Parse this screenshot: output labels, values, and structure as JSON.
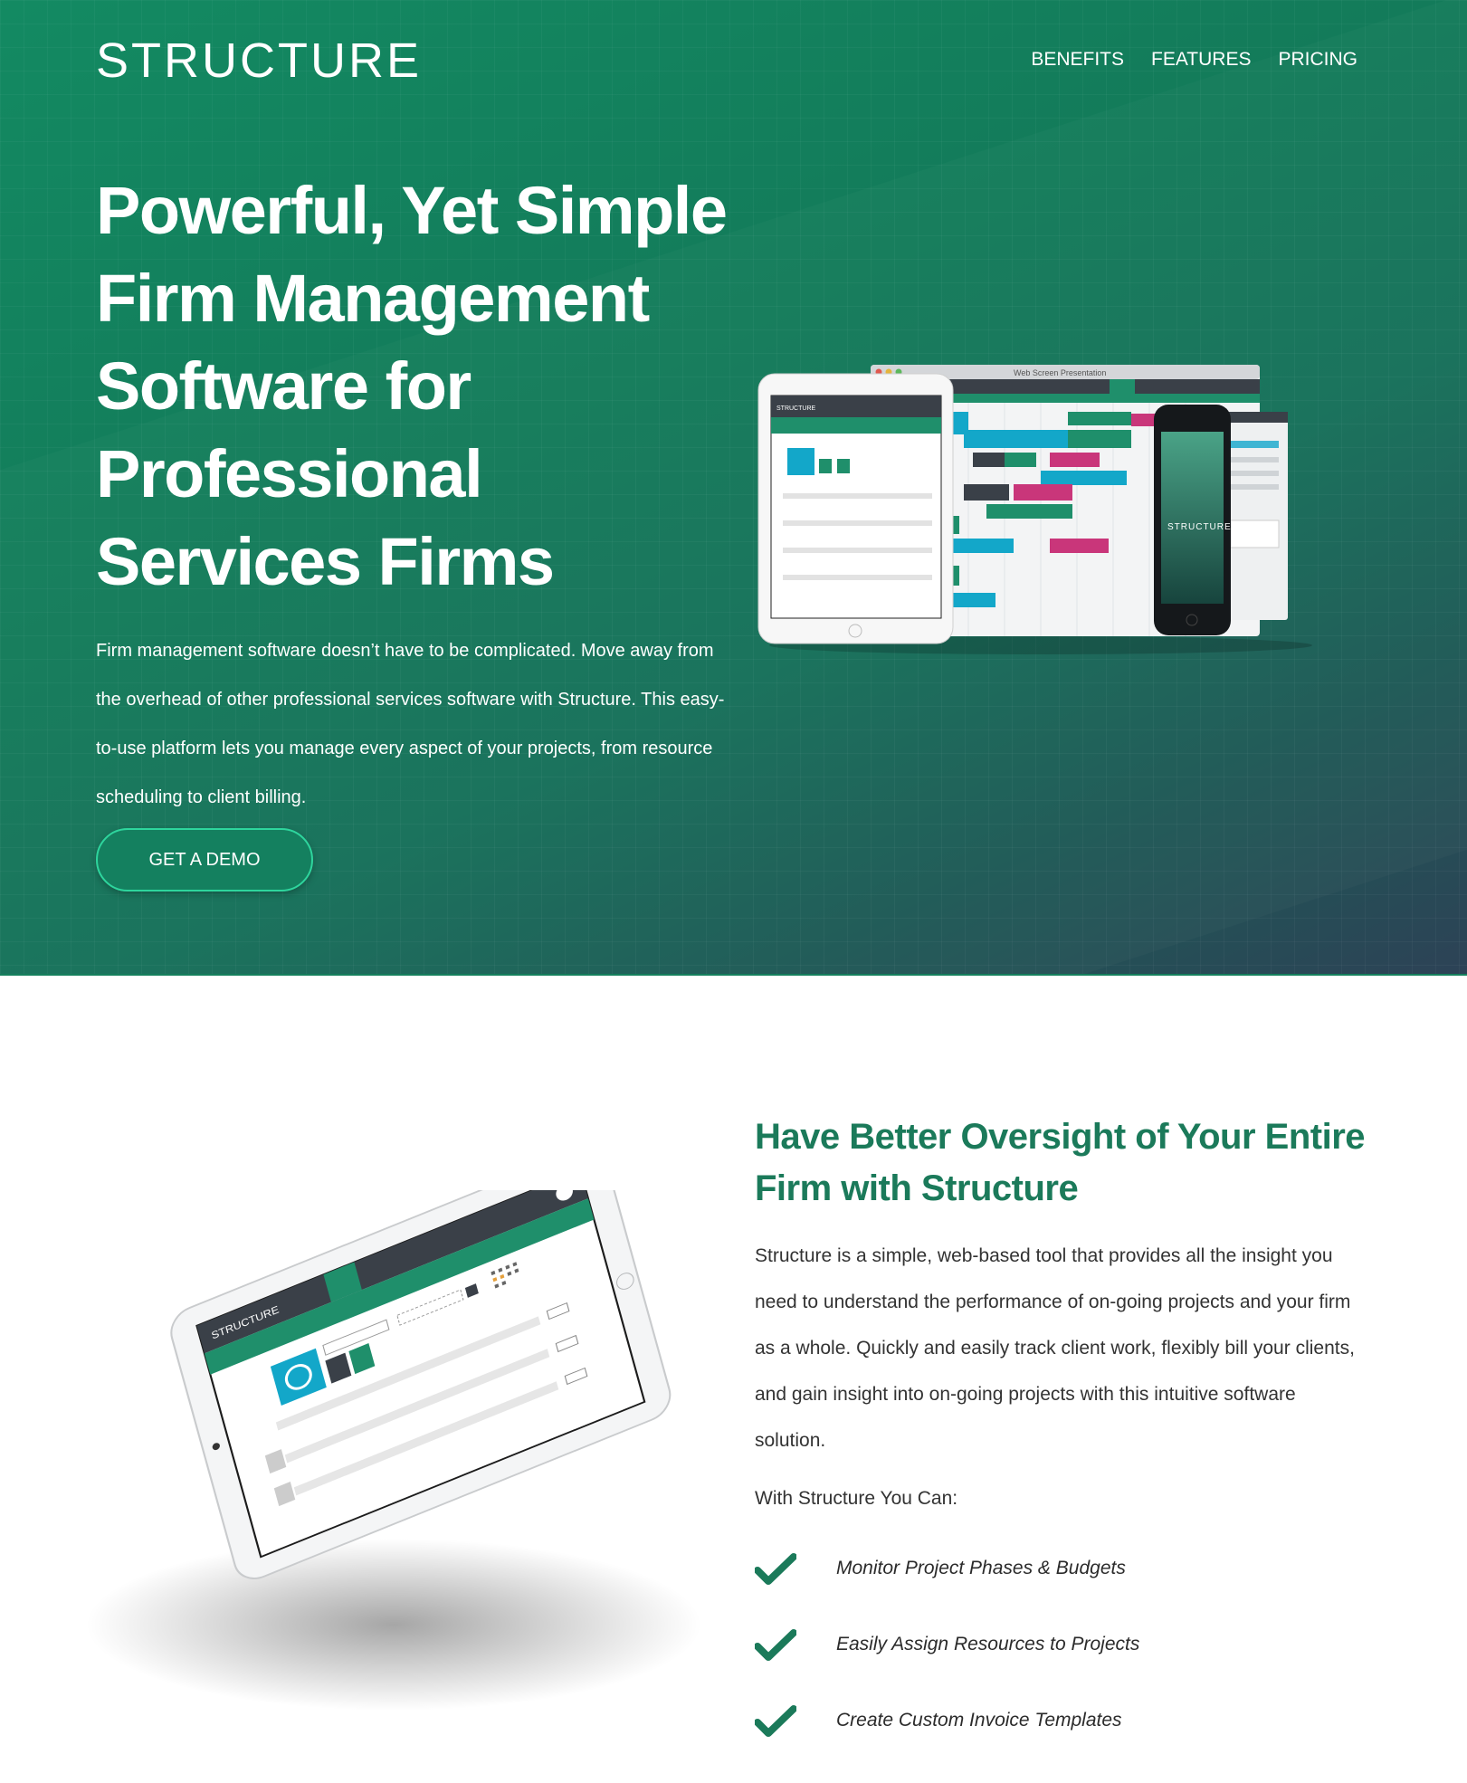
{
  "brand": {
    "logo": "STRUCTURE",
    "accent": "#1b7a5a",
    "button_border": "#2ed59d"
  },
  "nav": {
    "items": [
      "BENEFITS",
      "FEATURES",
      "PRICING"
    ]
  },
  "hero": {
    "title": "Powerful, Yet Simple Firm Management Software for Professional Services Firms",
    "text": "Firm management software doesn’t have to be complicated. Move away from the overhead of other professional services software with Structure. This easy-to-use platform lets you manage every aspect of your projects, from resource scheduling to client billing.",
    "cta": "GET A DEMO"
  },
  "devices": {
    "window_title": "Web Screen Presentation",
    "phone_brand": "STRUCTURE",
    "tablet_brand": "STRUCTURE"
  },
  "benefits": {
    "title": "Have Better Oversight of Your Entire Firm with Structure",
    "text": "Structure is a simple, web-based tool that provides all the insight you need to understand the performance of on-going projects and your firm as a whole. Quickly and easily track client work, flexibly bill your clients, and gain insight into on-going projects with this intuitive software solution.",
    "subhead": "With Structure You Can:",
    "features": [
      "Monitor Project Phases & Budgets",
      "Easily Assign Resources to Projects",
      "Create Custom Invoice Templates"
    ]
  }
}
